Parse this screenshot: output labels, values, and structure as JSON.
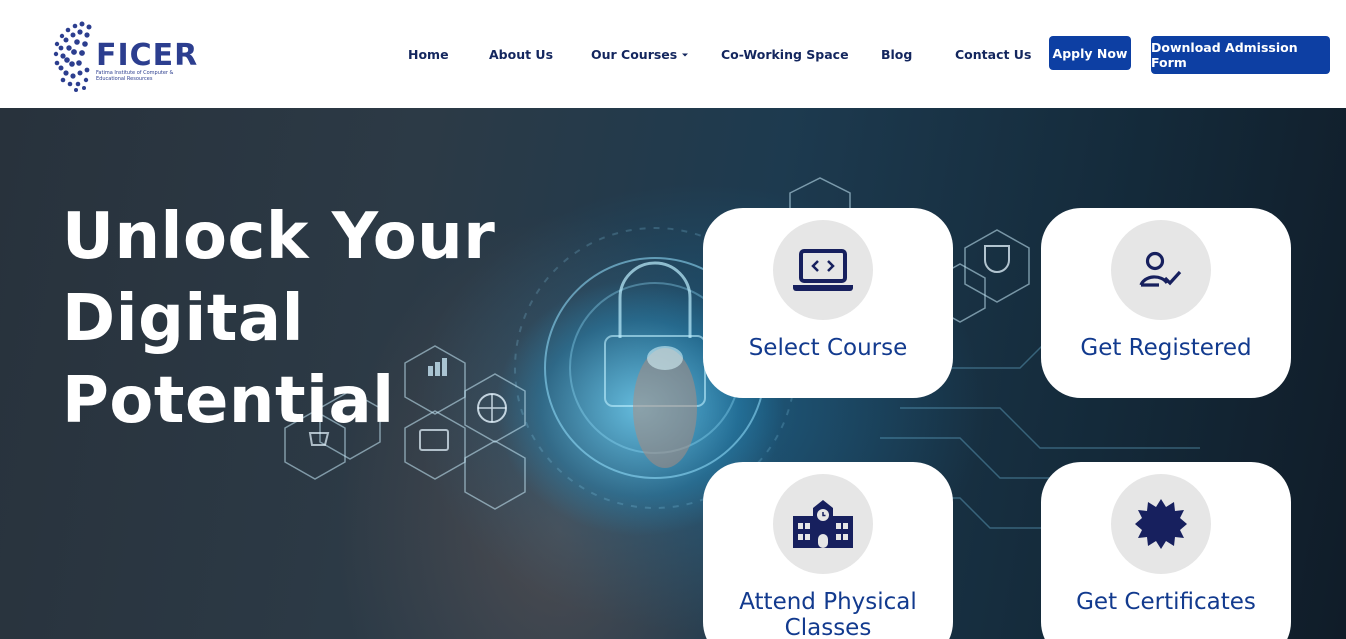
{
  "logo": {
    "name": "FICER",
    "tagline": "Fatima Institute of Computer & Educational Resources"
  },
  "nav": {
    "items": [
      "Home",
      "About Us",
      "Our Courses",
      "Co-Working Space",
      "Blog",
      "Contact Us"
    ],
    "dropdown_icon": "caret-down-icon",
    "apply_label": "Apply Now",
    "download_label": "Download Admission Form"
  },
  "hero": {
    "title_line1": "Unlock Your",
    "title_line2": "Digital",
    "title_line3": "Potential"
  },
  "steps": [
    {
      "label": "Select Course",
      "icon": "laptop-code-icon"
    },
    {
      "label": "Get Registered",
      "icon": "user-check-icon"
    },
    {
      "label": "Attend Physical Classes",
      "icon": "school-building-icon"
    },
    {
      "label": "Get Certificates",
      "icon": "certificate-badge-icon"
    }
  ],
  "colors": {
    "brand": "#0d3fa3",
    "nav_text": "#13265e",
    "card_text": "#123a8e",
    "icon": "#17205e"
  }
}
